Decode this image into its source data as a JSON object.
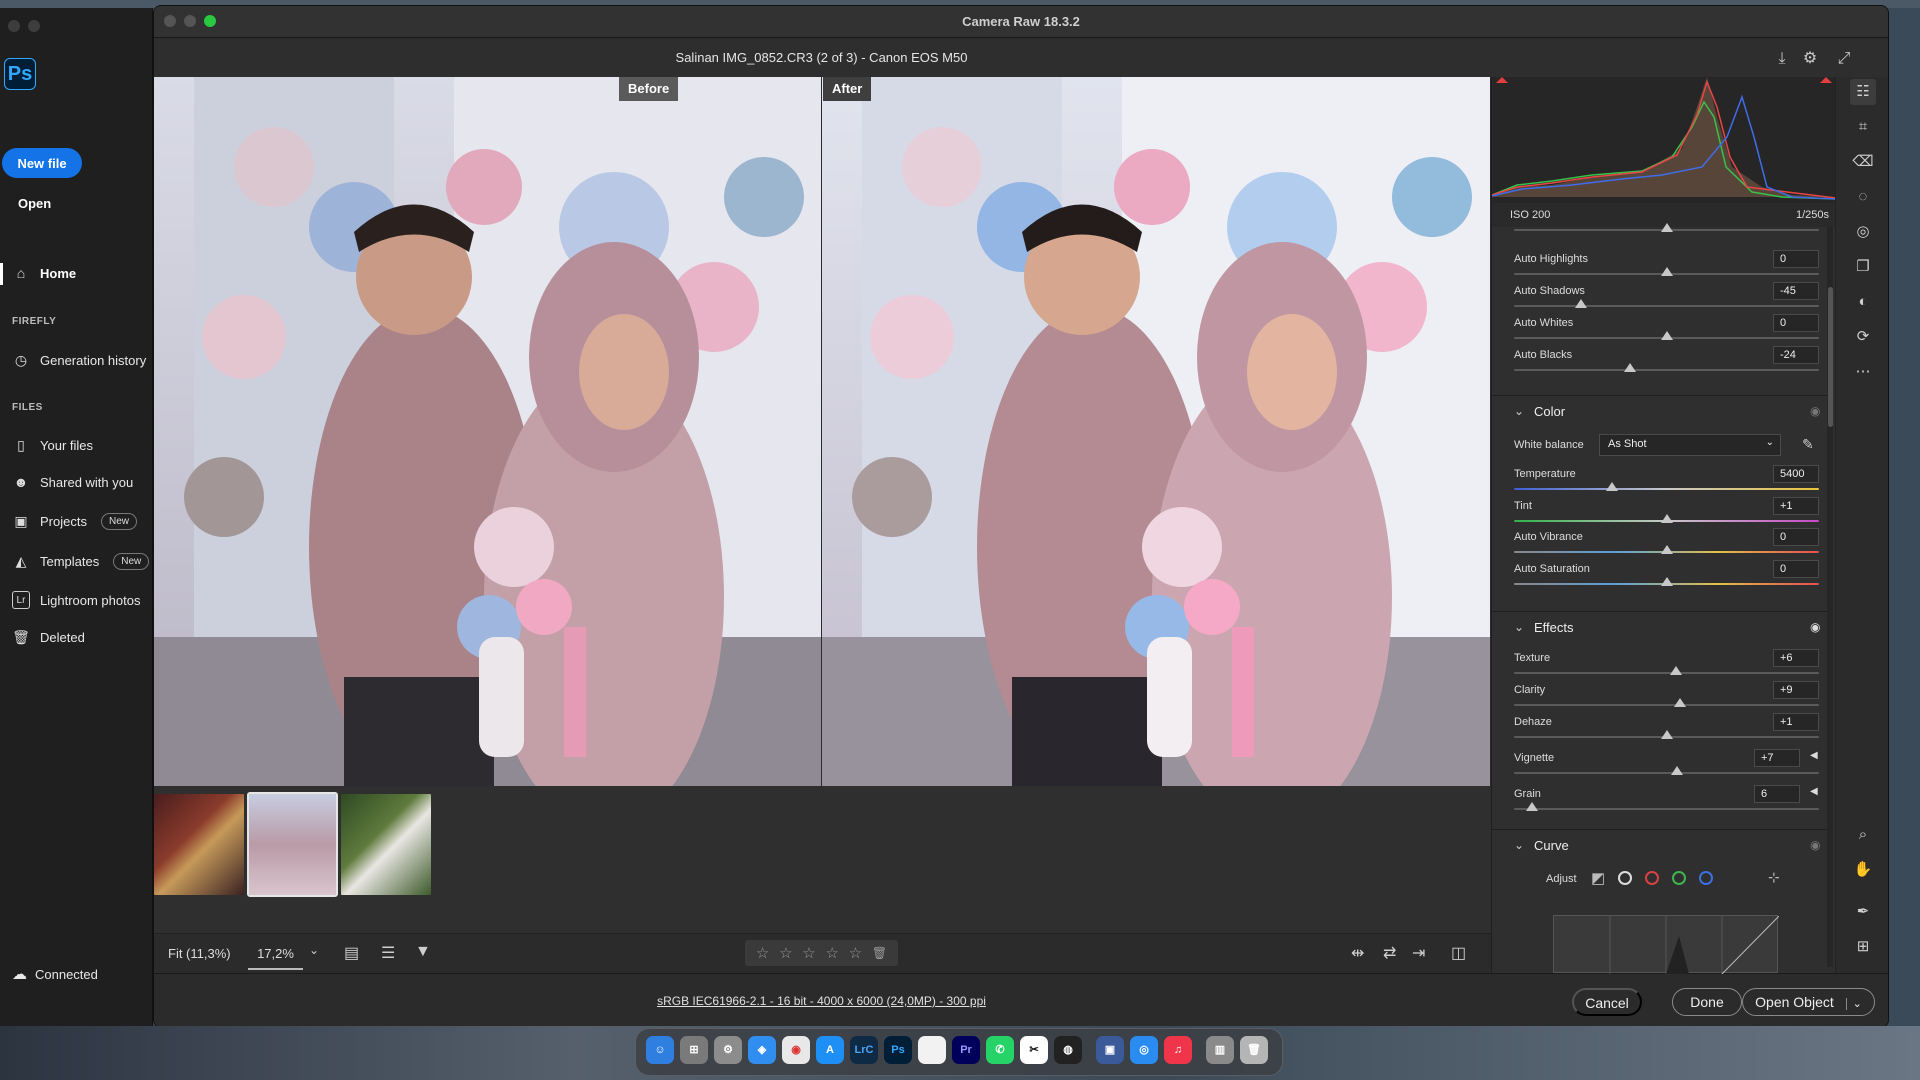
{
  "ps_home": {
    "logo": "Ps",
    "new_file": "New file",
    "open": "Open",
    "home": "Home",
    "section_firefly": "FIREFLY",
    "generation_history": "Generation history",
    "section_files": "FILES",
    "your_files": "Your files",
    "shared_with_you": "Shared with you",
    "projects": "Projects",
    "templates": "Templates",
    "lightroom_photos": "Lightroom photos",
    "deleted": "Deleted",
    "new_tag": "New",
    "connected": "Connected"
  },
  "camera_raw": {
    "window_title": "Camera Raw 18.3.2",
    "file_title": "Salinan IMG_0852.CR3 (2 of 3)  -  Canon EOS M50",
    "before_label": "Before",
    "after_label": "After",
    "fit_label": "Fit (11,3%)",
    "zoom_label": "17,2%",
    "footer_info": "sRGB IEC61966-2.1 - 16 bit - 4000 x 6000 (24,0MP) - 300 ppi",
    "cancel": "Cancel",
    "done": "Done",
    "open_object": "Open Object"
  },
  "histogram": {
    "iso": "ISO 200",
    "shutter": "1/250s"
  },
  "basic_sliders": [
    {
      "label": "Auto Highlights",
      "value": "0",
      "position": 0.5
    },
    {
      "label": "Auto Shadows",
      "value": "-45",
      "position": 0.22
    },
    {
      "label": "Auto Whites",
      "value": "0",
      "position": 0.5
    },
    {
      "label": "Auto Blacks",
      "value": "-24",
      "position": 0.38
    }
  ],
  "color": {
    "title": "Color",
    "white_balance_label": "White balance",
    "white_balance_value": "As Shot",
    "sliders": [
      {
        "label": "Temperature",
        "value": "5400",
        "position": 0.32
      },
      {
        "label": "Tint",
        "value": "+1",
        "position": 0.5
      },
      {
        "label": "Auto Vibrance",
        "value": "0",
        "position": 0.5
      },
      {
        "label": "Auto Saturation",
        "value": "0",
        "position": 0.5
      }
    ]
  },
  "effects": {
    "title": "Effects",
    "sliders": [
      {
        "label": "Texture",
        "value": "+6",
        "position": 0.53
      },
      {
        "label": "Clarity",
        "value": "+9",
        "position": 0.545
      },
      {
        "label": "Dehaze",
        "value": "+1",
        "position": 0.5
      },
      {
        "label": "Vignette",
        "value": "+7",
        "position": 0.535
      },
      {
        "label": "Grain",
        "value": "6",
        "position": 0.06
      }
    ]
  },
  "curve": {
    "title": "Curve",
    "adjust_label": "Adjust"
  },
  "colors": {
    "accent": "#1473e6",
    "panel_bg": "#2f2f2f"
  }
}
